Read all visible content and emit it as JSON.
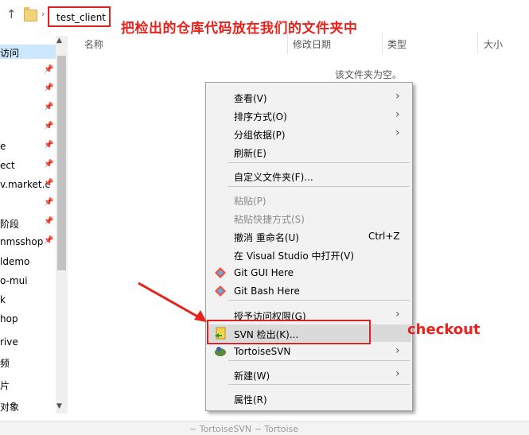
{
  "address_bar": {
    "up_arrow": "↑",
    "crumb_arrow": "›",
    "crumb": "test_client"
  },
  "annotations": {
    "top": "把检出的仓库代码放在我们的文件夹中",
    "checkout": "checkout"
  },
  "nav": {
    "items": [
      {
        "label": "访问",
        "selected": true,
        "pinned": false
      },
      {
        "label": "",
        "pinned": true
      },
      {
        "label": "",
        "pinned": true
      },
      {
        "label": "",
        "pinned": true
      },
      {
        "label": "",
        "pinned": true
      },
      {
        "label": "e",
        "pinned": true
      },
      {
        "label": "ect",
        "pinned": true
      },
      {
        "label": "v.market.c",
        "pinned": true
      },
      {
        "label": "",
        "pinned": true
      },
      {
        "label": "阶段",
        "pinned": true
      },
      {
        "label": "nmsshop",
        "pinned": true
      },
      {
        "label": "ldemo",
        "pinned": false
      },
      {
        "label": "o-mui",
        "pinned": false
      },
      {
        "label": "k",
        "pinned": false
      },
      {
        "label": "hop",
        "pinned": false
      },
      {
        "label": "rive",
        "pinned": false
      },
      {
        "label": "频",
        "pinned": false
      },
      {
        "label": "片",
        "pinned": false
      },
      {
        "label": "对象",
        "pinned": false
      }
    ],
    "pin_glyph": "📌"
  },
  "columns": {
    "name": "名称",
    "modified": "修改日期",
    "type": "类型",
    "size": "大小"
  },
  "empty_message": "该文件夹为空。",
  "context_menu": {
    "arrow_glyph": "›",
    "items": [
      {
        "label": "查看(V)",
        "submenu": true
      },
      {
        "label": "排序方式(O)",
        "submenu": true
      },
      {
        "label": "分组依据(P)",
        "submenu": true
      },
      {
        "label": "刷新(E)"
      },
      {
        "label": "自定义文件夹(F)..."
      },
      {
        "label": "粘贴(P)",
        "disabled": true
      },
      {
        "label": "粘贴快捷方式(S)",
        "disabled": true
      },
      {
        "label": "撤消 重命名(U)",
        "shortcut": "Ctrl+Z"
      },
      {
        "label": "在 Visual Studio 中打开(V)"
      },
      {
        "label": "Git GUI Here",
        "icon": "git-icon"
      },
      {
        "label": "Git Bash Here",
        "icon": "git-icon"
      },
      {
        "label": "授予访问权限(G)",
        "submenu": true
      },
      {
        "label": "SVN 检出(K)...",
        "icon": "svn-checkout-icon",
        "highlighted": true
      },
      {
        "label": "TortoiseSVN",
        "icon": "tortoisesvn-icon",
        "submenu": true
      },
      {
        "label": "新建(W)",
        "submenu": true
      },
      {
        "label": "属性(R)"
      }
    ]
  },
  "colors": {
    "annotation_red": "#e8221b",
    "selection_blue": "#cce8ff"
  },
  "bottom_hint": "~ TortoiseSVN  ~ Tortoise"
}
